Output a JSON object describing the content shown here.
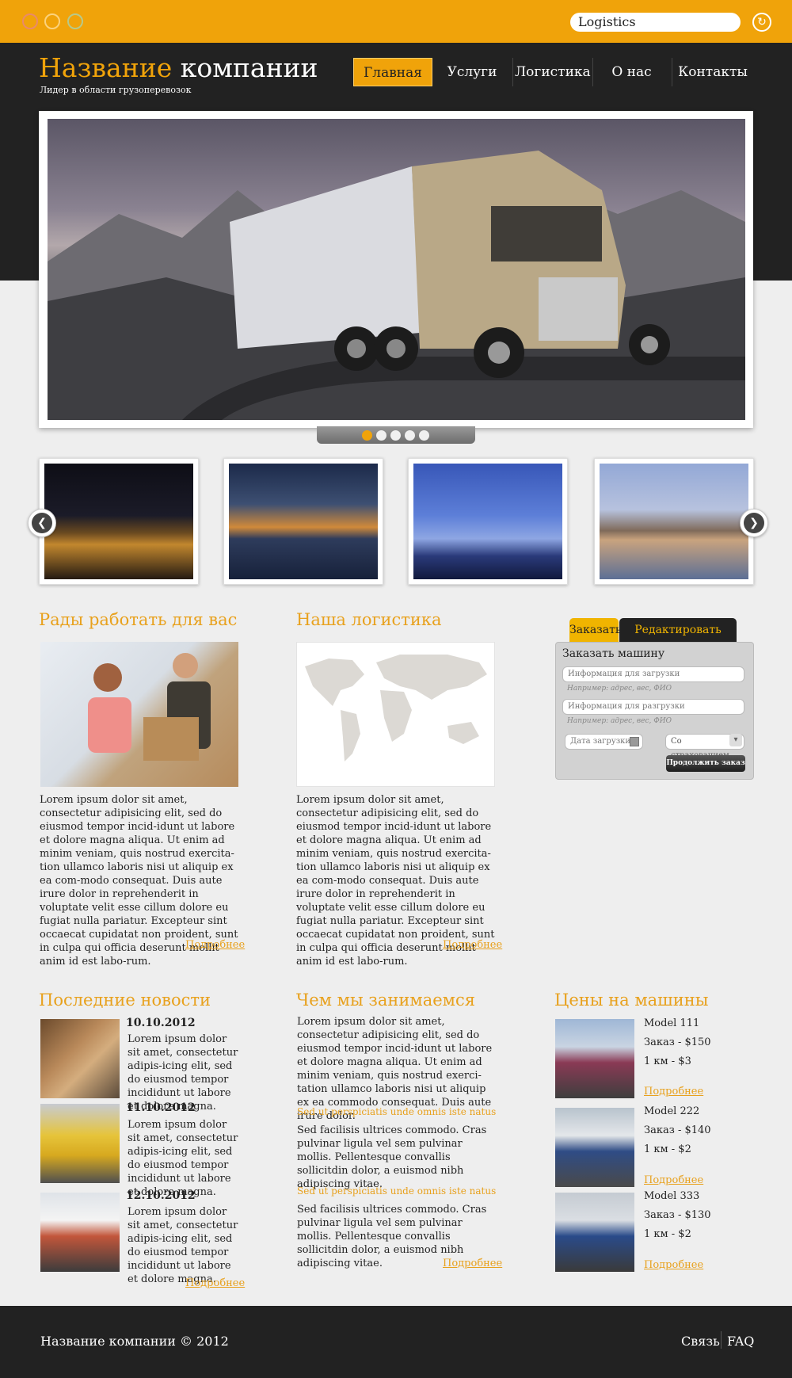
{
  "search": {
    "value": "Logistics"
  },
  "logo": {
    "part1": "Название",
    "part2": "компании",
    "tagline": "Лидер в области грузоперевозок"
  },
  "nav": [
    "Главная",
    "Услуги",
    "Логистика",
    "О нас",
    "Контакты"
  ],
  "slider": {
    "total": 5,
    "active": 1
  },
  "section1": {
    "title": "Рады работать для вас",
    "text": "Lorem ipsum dolor sit amet, consectetur adipisicing elit, sed do eiusmod tempor incid-idunt ut labore et dolore magna aliqua. Ut enim ad minim veniam, quis nostrud exercita-tion ullamco laboris nisi ut aliquip ex ea com-modo consequat. Duis aute irure dolor in reprehenderit in voluptate velit esse cillum dolore eu fugiat nulla pariatur. Excepteur sint occaecat cupidatat non proident, sunt in culpa qui officia deserunt mollit anim id est labo-rum.",
    "more": "Подробнее"
  },
  "section2": {
    "title": "Наша логистика",
    "text": "Lorem ipsum dolor sit amet, consectetur adipisicing elit, sed do eiusmod tempor incid-idunt ut labore et dolore magna aliqua. Ut enim ad minim veniam, quis nostrud exercita-tion ullamco laboris nisi ut aliquip ex ea com-modo consequat. Duis aute irure dolor in reprehenderit in voluptate velit esse cillum dolore eu fugiat nulla pariatur. Excepteur sint occaecat cupidatat non proident, sunt in culpa qui officia deserunt mollit anim id est labo-rum.",
    "more": "Подробнее"
  },
  "order": {
    "tab_order": "Заказать",
    "tab_edit": "Редактировать заказ",
    "title": "Заказать машину",
    "load_placeholder": "Информация для загрузки",
    "load_hint": "Например: адрес, вес, ФИО",
    "unload_placeholder": "Информация для разгрузки",
    "unload_hint": "Например: адрес, вес, ФИО",
    "date_placeholder": "Дата загрузки",
    "insurance_value": "Со страхованием",
    "continue": "Продолжить заказ"
  },
  "news": {
    "title": "Последние новости",
    "items": [
      {
        "date": "10.10.2012",
        "text": "Lorem ipsum dolor sit amet, consectetur adipis-icing elit, sed do eiusmod tempor incididunt ut labore et dolore magna."
      },
      {
        "date": "11.10.2012",
        "text": "Lorem ipsum dolor sit amet, consectetur adipis-icing elit, sed do eiusmod tempor incididunt ut labore et dolore magna."
      },
      {
        "date": "12.10.2012",
        "text": "Lorem ipsum dolor sit amet, consectetur adipis-icing elit, sed do eiusmod tempor incididunt ut labore et dolore magna."
      }
    ],
    "more": "Подробнее"
  },
  "about": {
    "title": "Чем мы занимаемся",
    "intro": "Lorem ipsum dolor sit amet, consectetur adipisicing elit, sed do eiusmod tempor incid-idunt ut labore et dolore magna aliqua. Ut enim ad minim veniam, quis nostrud exerci-tation ullamco laboris nisi ut aliquip ex ea commodo consequat. Duis aute irure dolor.",
    "sub1_title": "Sed ut perspiciatis unde omnis iste natus",
    "sub1_text": "Sed facilisis ultrices commodo. Cras pulvinar ligula vel sem pulvinar mollis. Pellentesque convallis sollicitdin dolor, a euismod nibh adipiscing vitae.",
    "sub2_title": "Sed ut perspiciatis unde omnis iste natus",
    "sub2_text": "Sed facilisis ultrices commodo. Cras pulvinar ligula vel sem pulvinar mollis. Pellentesque convallis sollicitdin dolor, a euismod nibh adipiscing vitae.",
    "more": "Подробнее"
  },
  "prices": {
    "title": "Цены на машины",
    "items": [
      {
        "model": "Model 111",
        "order": "Заказ - $150",
        "km": "1 км - $3",
        "more": "Подробнее"
      },
      {
        "model": "Model 222",
        "order": "Заказ - $140",
        "km": "1 км - $2",
        "more": "Подробнее"
      },
      {
        "model": "Model 333",
        "order": "Заказ - $130",
        "km": "1 км - $2",
        "more": "Подробнее"
      }
    ]
  },
  "footer": {
    "copyright": "Название компании © 2012",
    "link1": "Связь",
    "link2": "FAQ"
  }
}
